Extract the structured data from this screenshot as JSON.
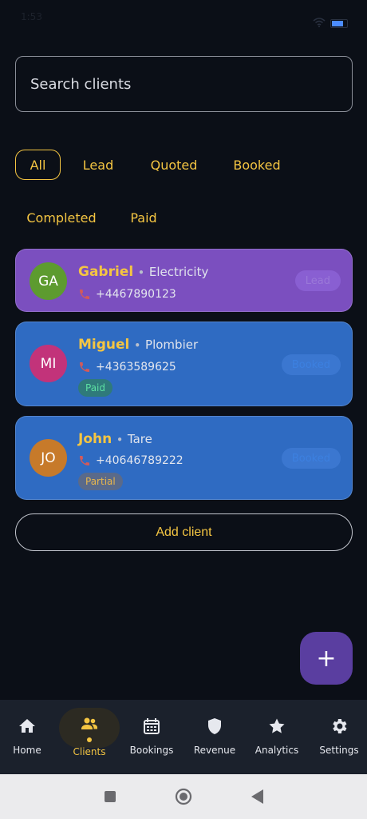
{
  "status_bar": {
    "time": "1:53",
    "icons": [
      "x-icon",
      "wifi-icon",
      "battery-icon"
    ]
  },
  "search": {
    "placeholder": "Search clients"
  },
  "filters": [
    {
      "label": "All",
      "active": true
    },
    {
      "label": "Lead",
      "active": false
    },
    {
      "label": "Quoted",
      "active": false
    },
    {
      "label": "Booked",
      "active": false
    },
    {
      "label": "Completed",
      "active": false
    },
    {
      "label": "Paid",
      "active": false
    }
  ],
  "clients": [
    {
      "initials": "GA",
      "name": "Gabriel",
      "trade": "Electricity",
      "phone": "+4467890123",
      "status": "Lead",
      "payment": "",
      "avatar_color": "#5d9b2f",
      "card_color": "#7b4fbf"
    },
    {
      "initials": "MI",
      "name": "Miguel",
      "trade": "Plombier",
      "phone": "+4363589625",
      "status": "Booked",
      "payment": "Paid",
      "avatar_color": "#c2337a",
      "card_color": "#2f6bc2"
    },
    {
      "initials": "JO",
      "name": "John",
      "trade": "Tare",
      "phone": "+40646789222",
      "status": "Booked",
      "payment": "Partial",
      "avatar_color": "#c77a2a",
      "card_color": "#2f6bc2"
    }
  ],
  "add_client_label": "Add client",
  "fab_label": "+",
  "nav": [
    {
      "label": "Home",
      "icon": "home-icon",
      "active": false
    },
    {
      "label": "Clients",
      "icon": "people-icon",
      "active": true
    },
    {
      "label": "Bookings",
      "icon": "calendar-icon",
      "active": false
    },
    {
      "label": "Revenue",
      "icon": "shield-icon",
      "active": false
    },
    {
      "label": "Analytics",
      "icon": "star-icon",
      "active": false
    },
    {
      "label": "Settings",
      "icon": "gear-icon",
      "active": false
    }
  ],
  "colors": {
    "accent": "#f4c542",
    "background": "#0b0f17",
    "nav_bg": "#1b212c",
    "fab": "#5a3ea0"
  }
}
